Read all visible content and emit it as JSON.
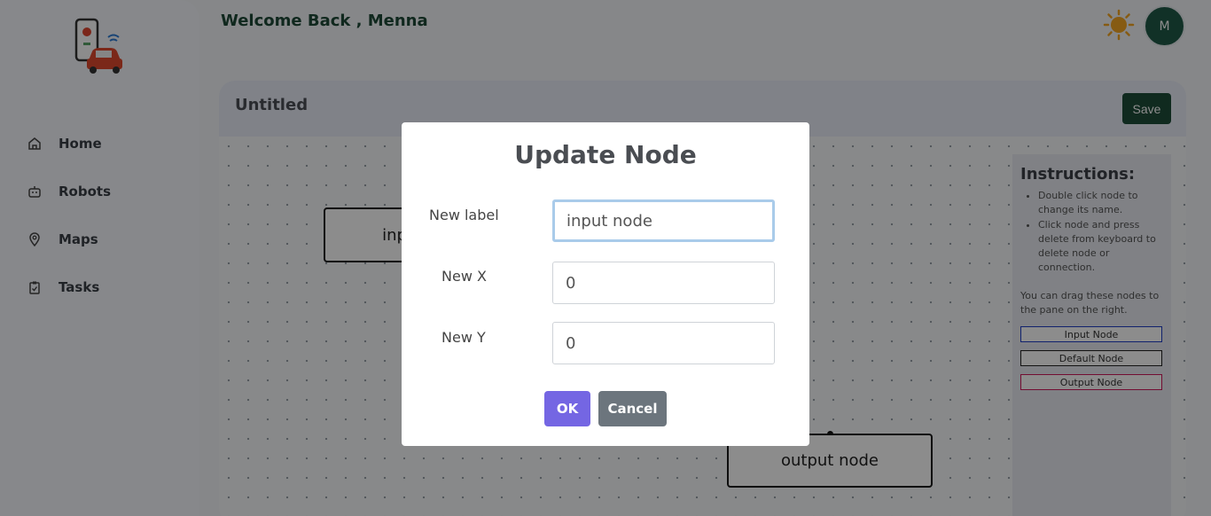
{
  "header": {
    "welcome": "Welcome Back , Menna",
    "avatar_initial": "M"
  },
  "sidebar": {
    "items": [
      {
        "label": "Home",
        "icon": "home-icon"
      },
      {
        "label": "Robots",
        "icon": "robot-icon"
      },
      {
        "label": "Maps",
        "icon": "map-pin-icon"
      },
      {
        "label": "Tasks",
        "icon": "clipboard-icon"
      }
    ]
  },
  "flow": {
    "title": "Untitled",
    "save_label": "Save",
    "nodes": {
      "input_visible": "inp",
      "output": "output node"
    }
  },
  "instructions": {
    "title": "Instructions:",
    "bullets": [
      "Double click node to change its name.",
      "Click node and press delete from keyboard to delete node or connection."
    ],
    "drag_hint": "You can drag these nodes to the pane on the right.",
    "palette": {
      "input": "Input Node",
      "default": "Default Node",
      "output": "Output Node"
    }
  },
  "modal": {
    "title": "Update Node",
    "label_field": {
      "label": "New label",
      "value": "input node"
    },
    "x_field": {
      "label": "New X",
      "value": "0"
    },
    "y_field": {
      "label": "New Y",
      "value": "0"
    },
    "ok_label": "OK",
    "cancel_label": "Cancel"
  },
  "colors": {
    "brand_dark_green": "#1e4d39",
    "ok_purple": "#7466e3",
    "cancel_gray": "#6c757d",
    "input_node_blue": "#1e3cc7",
    "output_node_pink": "#d0195b",
    "sun_orange": "#f5a623"
  }
}
